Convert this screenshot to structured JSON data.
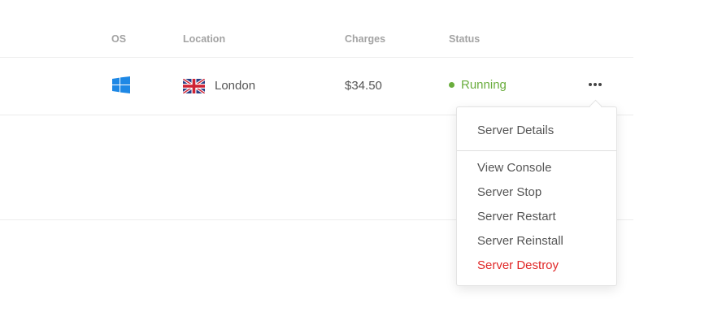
{
  "table": {
    "columns": {
      "os": "OS",
      "location": "Location",
      "charges": "Charges",
      "status": "Status"
    },
    "rows": [
      {
        "os_icon": "windows-icon",
        "flag_icon": "uk-flag-icon",
        "location": "London",
        "charges": "$34.50",
        "status": "Running",
        "status_color": "#6aad3d"
      }
    ]
  },
  "actions_menu": {
    "trigger_icon": "more-dots-icon",
    "items": [
      {
        "label": "Server Details"
      },
      {
        "label": "View Console"
      },
      {
        "label": "Server Stop"
      },
      {
        "label": "Server Restart"
      },
      {
        "label": "Server Reinstall"
      },
      {
        "label": "Server Destroy",
        "color": "#e02727"
      }
    ]
  },
  "colors": {
    "accent_blue": "#1e88e5",
    "running_green": "#6aad3d",
    "danger_red": "#e02727",
    "header_text": "#a3a3a3"
  }
}
